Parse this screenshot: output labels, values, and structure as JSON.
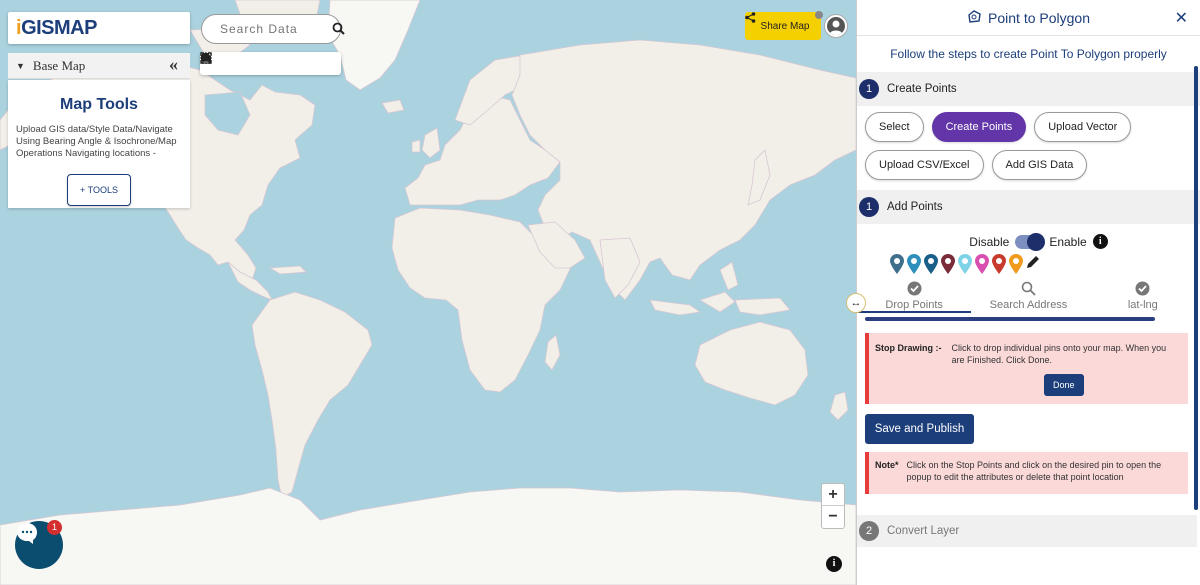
{
  "app": {
    "logo_text": "GISMAP",
    "logo_initial": "i",
    "basemap_label": "Base Map",
    "collapse_glyph": "«",
    "map_tools_title": "Map Tools",
    "map_tools_desc": "Upload GIS data/Style Data/Navigate Using Bearing Angle & Isochrone/Map Operations Navigating locations -",
    "tools_button": "+ TOOLS",
    "search_placeholder": "Search Data",
    "share_label": "Share Map",
    "zoom_in": "+",
    "zoom_out": "−",
    "info_glyph": "i",
    "chat_badge": "1",
    "toolbar_icons": [
      "locate-icon",
      "fullscreen-icon",
      "print-icon",
      "zoom-search-icon",
      "measure-icon",
      "layers-icon"
    ]
  },
  "panel": {
    "title": "Point to Polygon",
    "close_glyph": "✕",
    "subtitle": "Follow the steps to create Point To Polygon properly",
    "step1": {
      "num": "1",
      "title": "Create Points"
    },
    "buttons": [
      {
        "label": "Select",
        "active": false
      },
      {
        "label": "Create Points",
        "active": true
      },
      {
        "label": "Upload Vector",
        "active": false
      },
      {
        "label": "Upload CSV/Excel",
        "active": false
      },
      {
        "label": "Add GIS Data",
        "active": false
      }
    ],
    "step2": {
      "num": "1",
      "title": "Add Points"
    },
    "toggle": {
      "off_label": "Disable",
      "on_label": "Enable",
      "state": "Enable"
    },
    "pin_colors": [
      "#3f6f8c",
      "#2e8fbd",
      "#1a5e8a",
      "#7b2c3b",
      "#7fd3e8",
      "#d94fb0",
      "#c73a2e",
      "#f09a1e"
    ],
    "tabs": [
      {
        "label": "Drop Points",
        "icon": "check-circle-icon",
        "selected": true
      },
      {
        "label": "Search Address",
        "icon": "search-icon",
        "selected": false
      },
      {
        "label": "lat-lng",
        "icon": "check-circle-icon",
        "selected": false
      }
    ],
    "alert": {
      "title": "Stop Drawing :-",
      "text": "Click to drop individual pins onto your map. When you are Finished. Click Done.",
      "button": "Done"
    },
    "save_button": "Save and Publish",
    "note": {
      "title": "Note*",
      "text": "Click on the Stop Points and click on the desired pin to open the popup to edit the attributes or delete that point location"
    },
    "step3": {
      "num": "2",
      "title": "Convert Layer"
    }
  },
  "colors": {
    "ocean": "#aad3df",
    "land": "#f2efe9",
    "brand": "#1c3e7a",
    "active_button": "#6236a8",
    "share_button": "#f5d000",
    "alert_bg": "#fbd9d9",
    "alert_border": "#e63b3b"
  }
}
